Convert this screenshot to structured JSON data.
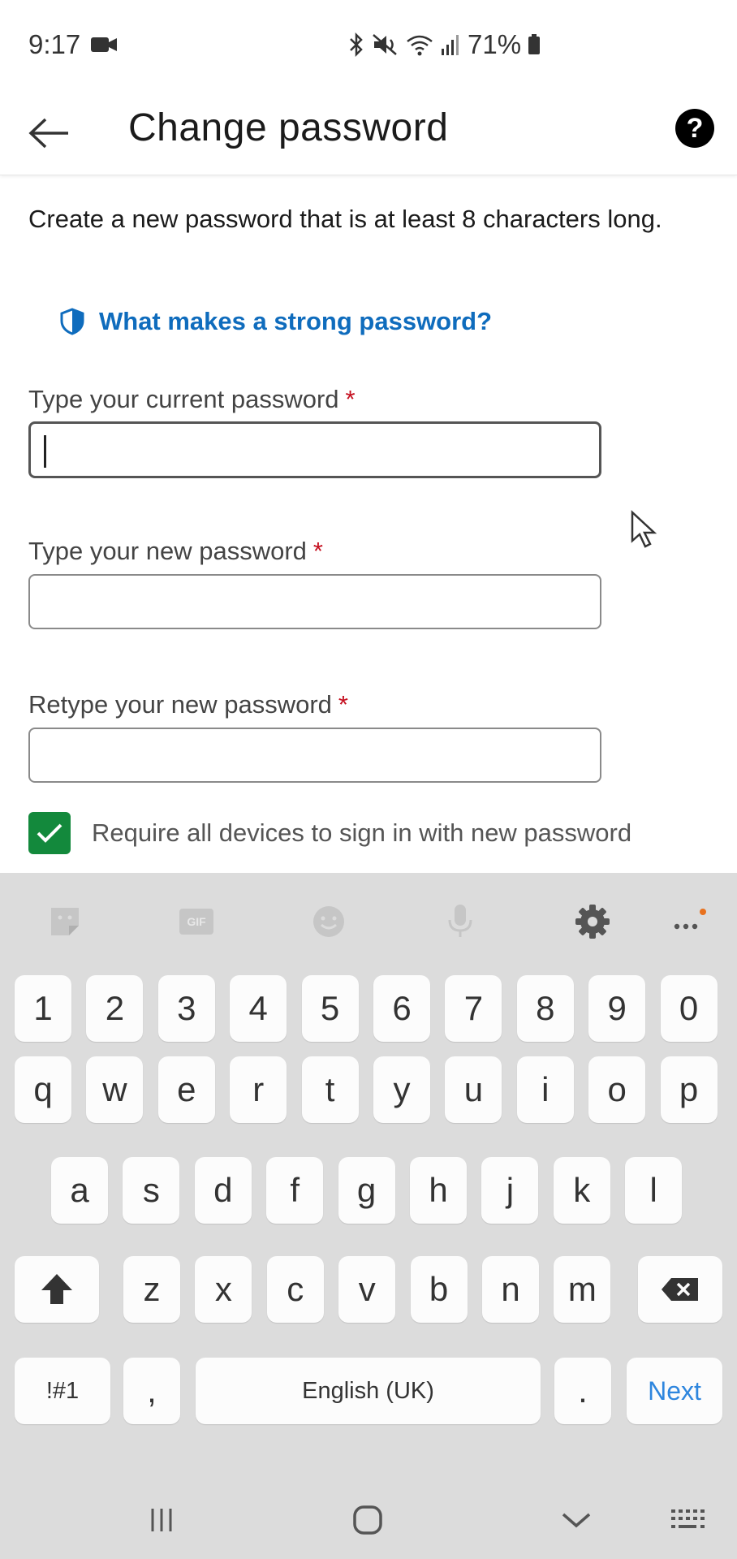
{
  "status_bar": {
    "time": "9:17",
    "battery": "71%",
    "icons": [
      "video-camera-icon",
      "bluetooth-icon",
      "mute-icon",
      "wifi-icon",
      "signal-icon",
      "battery-icon"
    ]
  },
  "header": {
    "title": "Change password",
    "back_icon": "back-arrow-icon",
    "help_icon": "help-icon",
    "help_glyph": "?"
  },
  "content": {
    "intro": "Create a new password that is at least 8 characters long.",
    "strong_link": "What makes a strong password?",
    "fields": [
      {
        "label": "Type your current password",
        "required_mark": "*",
        "value": ""
      },
      {
        "label": "Type your new password",
        "required_mark": "*",
        "value": ""
      },
      {
        "label": "Retype your new password",
        "required_mark": "*",
        "value": ""
      }
    ],
    "checkbox": {
      "label": "Require all devices to sign in with new password",
      "checked": true
    }
  },
  "keyboard": {
    "toolbar": [
      "sticker-icon",
      "gif-icon",
      "emoji-icon",
      "microphone-icon",
      "settings-icon",
      "more-icon"
    ],
    "gif_label": "GIF",
    "row_numbers": [
      "1",
      "2",
      "3",
      "4",
      "5",
      "6",
      "7",
      "8",
      "9",
      "0"
    ],
    "row_q": [
      "q",
      "w",
      "e",
      "r",
      "t",
      "y",
      "u",
      "i",
      "o",
      "p"
    ],
    "row_a": [
      "a",
      "s",
      "d",
      "f",
      "g",
      "h",
      "j",
      "k",
      "l"
    ],
    "row_z": [
      "z",
      "x",
      "c",
      "v",
      "b",
      "n",
      "m"
    ],
    "symbols_key": "!#1",
    "comma_key": ",",
    "space_key": "English (UK)",
    "period_key": ".",
    "action_key": "Next"
  },
  "nav_bar": {
    "buttons": [
      "recent-apps-icon",
      "home-icon",
      "back-chevron-icon",
      "keyboard-switch-icon"
    ]
  },
  "colors": {
    "link": "#0f6cbd",
    "checkbox": "#13893c",
    "required": "#c50f1f",
    "next": "#2e86de",
    "keyboard_bg": "#dcdcdc"
  }
}
